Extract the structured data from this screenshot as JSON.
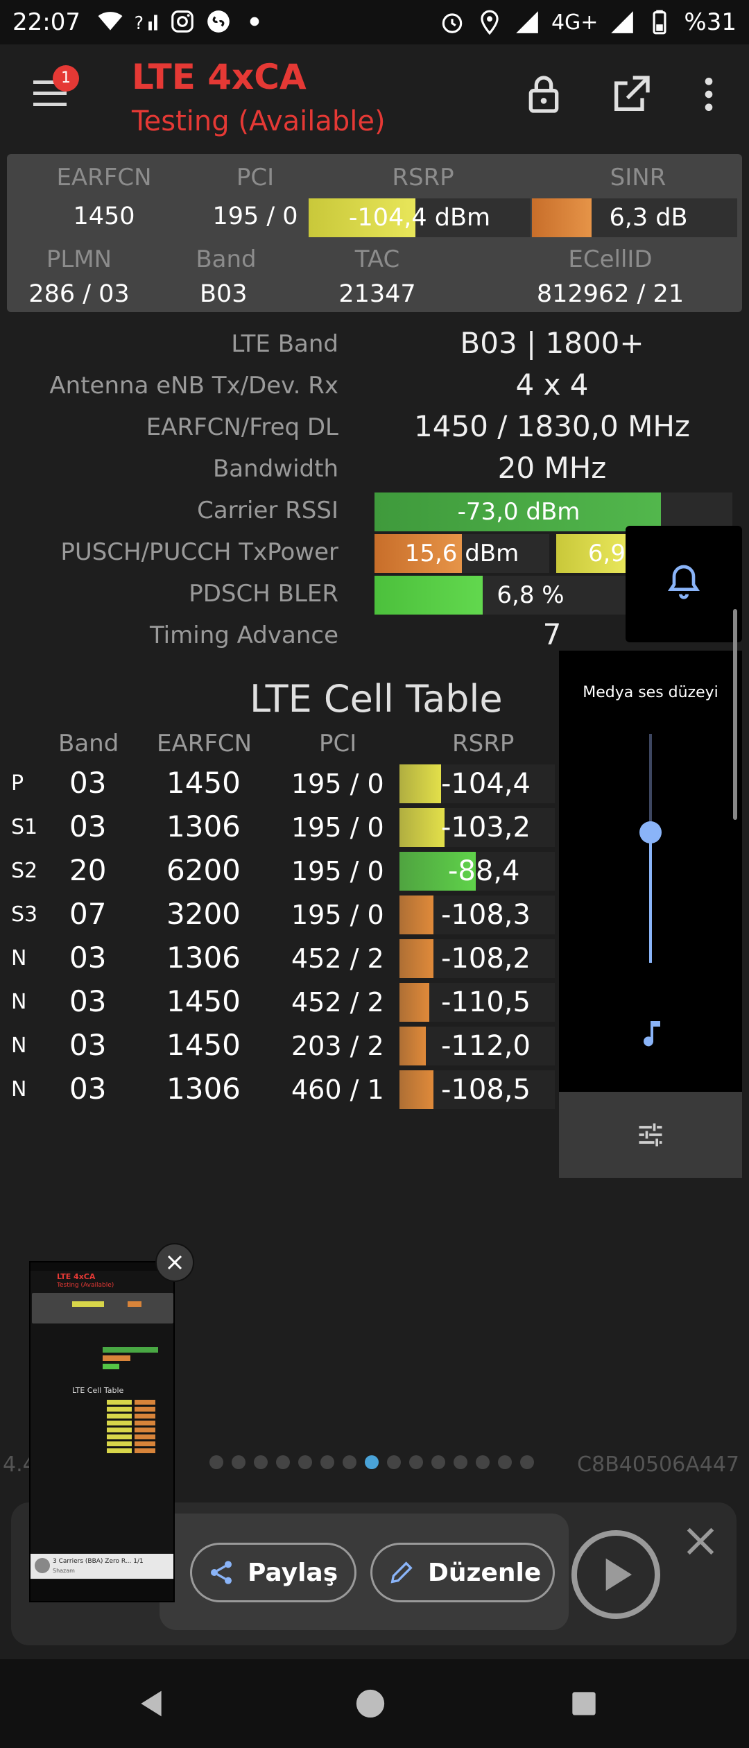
{
  "status_bar": {
    "time": "22:07",
    "network": "4G+",
    "battery": "%31",
    "icons": [
      "wifi-icon",
      "signal-r-icon",
      "instagram-icon",
      "shazam-icon",
      "dot-icon",
      "alarm-icon",
      "location-icon",
      "signal-icon",
      "signal-icon-2",
      "battery-icon"
    ]
  },
  "appbar": {
    "title": "LTE 4xCA",
    "subtitle": "Testing (Available)",
    "badge_count": "1",
    "icons": [
      "menu-icon",
      "lock-icon",
      "open-external-icon",
      "more-vert-icon"
    ]
  },
  "summary": {
    "labels": {
      "earfcn": "EARFCN",
      "pci": "PCI",
      "rsrp": "RSRP",
      "sinr": "SINR",
      "plmn": "PLMN",
      "band": "Band",
      "tac": "TAC",
      "ecellid": "ECellID"
    },
    "earfcn": "1450",
    "pci": "195 / 0",
    "rsrp": "-104,4 dBm",
    "rsrp_level": 0.48,
    "sinr": "6,3 dB",
    "sinr_level": 0.29,
    "plmn": "286 / 03",
    "band": "B03",
    "tac": "21347",
    "ecellid": "812962 / 21"
  },
  "details": {
    "lte_band_label": "LTE Band",
    "lte_band": "B03 | 1800+",
    "antenna_label": "Antenna eNB Tx/Dev. Rx",
    "antenna": "4 x 4",
    "earfcn_freq_label": "EARFCN/Freq DL",
    "earfcn_freq": "1450 / 1830,0 MHz",
    "bandwidth_label": "Bandwidth",
    "bandwidth": "20 MHz",
    "carrier_rssi_label": "Carrier RSSI",
    "carrier_rssi": "-73,0 dBm",
    "carrier_rssi_level": 0.8,
    "txpower_label": "PUSCH/PUCCH TxPower",
    "pusch_txpower": "15,6 dBm",
    "pusch_level": 0.5,
    "pucch_txpower": "6,9",
    "pdsch_bler_label": "PDSCH BLER",
    "pdsch_bler": "6,8 %",
    "pdsch_bler_level": 0.3,
    "timing_advance_label": "Timing Advance",
    "timing_advance": "7"
  },
  "cell_table": {
    "title": "LTE Cell Table",
    "headers": {
      "band": "Band",
      "earfcn": "EARFCN",
      "pci": "PCI",
      "rsrp": "RSRP"
    },
    "rows": [
      {
        "type": "P",
        "band": "03",
        "earfcn": "1450",
        "pci": "195 / 0",
        "rsrp": "-104,4",
        "level": 0.27,
        "color": "#e3e04a"
      },
      {
        "type": "S1",
        "band": "03",
        "earfcn": "1306",
        "pci": "195 / 0",
        "rsrp": "-103,2",
        "level": 0.29,
        "color": "#e3e04a"
      },
      {
        "type": "S2",
        "band": "20",
        "earfcn": "6200",
        "pci": "195 / 0",
        "rsrp": "-88,4",
        "level": 0.49,
        "color": "#5fd24a"
      },
      {
        "type": "S3",
        "band": "07",
        "earfcn": "3200",
        "pci": "195 / 0",
        "rsrp": "-108,3",
        "level": 0.22,
        "color": "#e08a3a"
      },
      {
        "type": "N",
        "band": "03",
        "earfcn": "1306",
        "pci": "452 / 2",
        "rsrp": "-108,2",
        "level": 0.22,
        "color": "#e08a3a"
      },
      {
        "type": "N",
        "band": "03",
        "earfcn": "1450",
        "pci": "452 / 2",
        "rsrp": "-110,5",
        "level": 0.19,
        "color": "#e08a3a"
      },
      {
        "type": "N",
        "band": "03",
        "earfcn": "1450",
        "pci": "203 / 2",
        "rsrp": "-112,0",
        "level": 0.17,
        "color": "#e08a3a"
      },
      {
        "type": "N",
        "band": "03",
        "earfcn": "1306",
        "pci": "460 / 1",
        "rsrp": "-108,5",
        "level": 0.22,
        "color": "#e08a3a"
      }
    ]
  },
  "volume_panel": {
    "title": "Medya ses düzeyi",
    "level": 0.57,
    "icons": [
      "bell-icon",
      "music-note-icon",
      "equalizer-icon"
    ]
  },
  "screenshot_preview": {
    "page_dots_total": 15,
    "page_dot_active": 7,
    "left_faded_text": "4.4",
    "right_faded_text": "C8B40506A447",
    "share_label": "Paylaş",
    "edit_label": "Düzenle",
    "thumb_title": "LTE 4xCA",
    "thumb_subtitle": "Testing (Available)",
    "thumb_table_title": "LTE Cell Table",
    "thumb_notification": "3 Carriers (BBA) Zero R... 1/1",
    "thumb_notification_sub": "Shazam"
  },
  "colors": {
    "accent_red": "#e53935",
    "bar_yellow": "#e3e04a",
    "bar_green": "#5fd24a",
    "bar_orange": "#e08a3a",
    "volume_blue": "#8ab4f8"
  }
}
